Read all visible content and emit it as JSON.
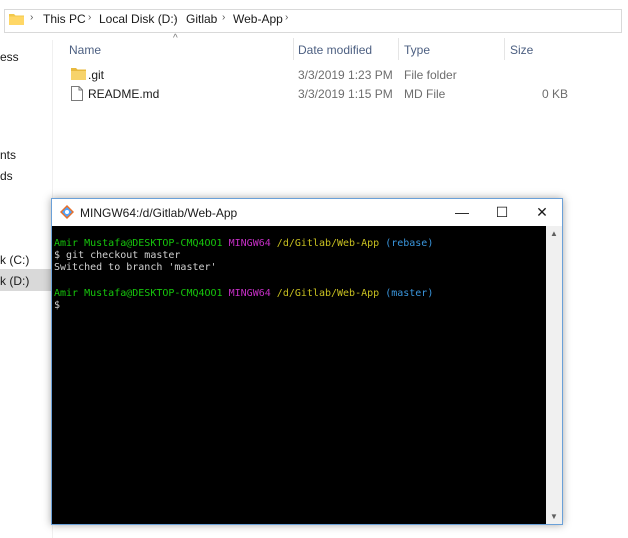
{
  "breadcrumb": {
    "items": [
      "This PC",
      "Local Disk (D:)",
      "Gitlab",
      "Web-App"
    ]
  },
  "nav": {
    "items": [
      "ess",
      "nts",
      "ds",
      "k (C:)",
      "k (D:)"
    ]
  },
  "columns": {
    "name": "Name",
    "date": "Date modified",
    "type": "Type",
    "size": "Size"
  },
  "files": [
    {
      "name": ".git",
      "date": "3/3/2019 1:23 PM",
      "type": "File folder",
      "size": "",
      "icon": "folder-icon"
    },
    {
      "name": "README.md",
      "date": "3/3/2019 1:15 PM",
      "type": "MD File",
      "size": "0 KB",
      "icon": "file-icon"
    }
  ],
  "terminal": {
    "title": "MINGW64:/d/Gitlab/Web-App",
    "prompt1": {
      "user": "Amir Mustafa@DESKTOP-CMQ4OO1",
      "env": "MINGW64",
      "path": "/d/Gitlab/Web-App",
      "branch": "(rebase)"
    },
    "command": "$ git checkout master",
    "output": "Switched to branch 'master'",
    "prompt2": {
      "user": "Amir Mustafa@DESKTOP-CMQ4OO1",
      "env": "MINGW64",
      "path": "/d/Gitlab/Web-App",
      "branch": "(master)"
    },
    "cursor_line": "$",
    "minimize": "—",
    "maximize": "☐",
    "close": "✕"
  },
  "colors": {
    "accent": "#6aa0d8",
    "folder": "#f2c94c",
    "prompt_user": "#16c60c",
    "prompt_env": "#c42ec4",
    "prompt_path": "#c8c020",
    "prompt_branch": "#3a96dd"
  }
}
